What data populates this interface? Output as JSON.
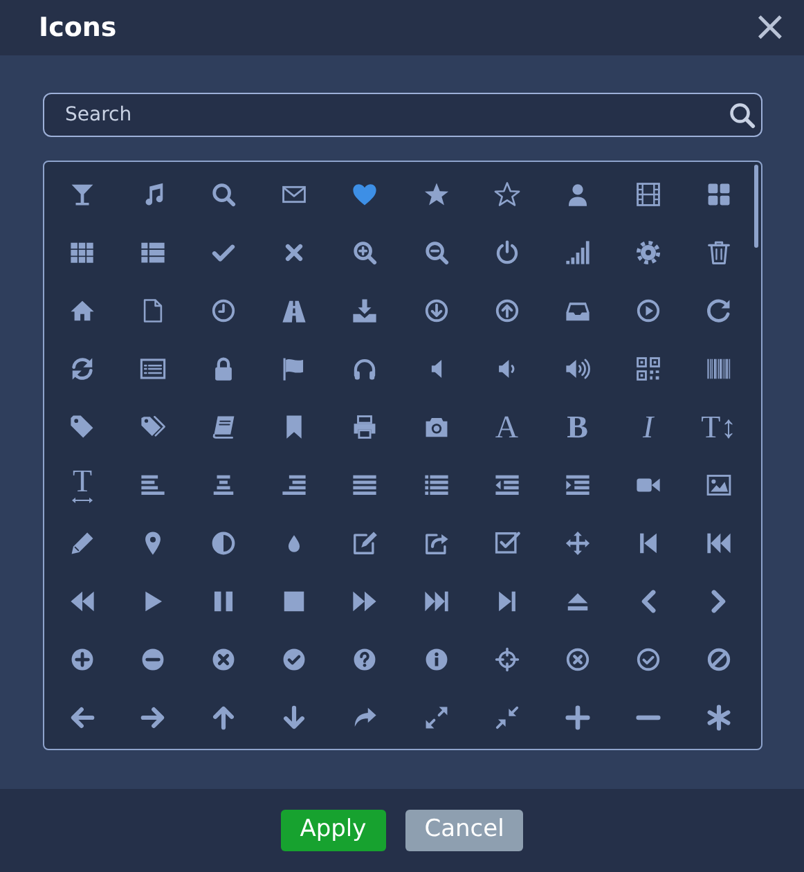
{
  "dialog": {
    "title": "Icons",
    "close": "×"
  },
  "search": {
    "placeholder": "Search"
  },
  "icons": [
    {
      "selected": false
    },
    {
      "selected": false
    },
    {
      "selected": false
    },
    {
      "selected": false
    },
    {
      "selected": true
    },
    {
      "selected": false
    },
    {
      "selected": false
    },
    {
      "selected": false
    },
    {
      "selected": false
    },
    {
      "selected": false
    },
    {
      "selected": false
    },
    {
      "selected": false
    },
    {
      "selected": false
    },
    {
      "selected": false
    },
    {
      "selected": false
    },
    {
      "selected": false
    },
    {
      "selected": false
    },
    {
      "selected": false
    },
    {
      "selected": false
    },
    {
      "selected": false
    },
    {
      "selected": false
    },
    {
      "selected": false
    },
    {
      "selected": false
    },
    {
      "selected": false
    },
    {
      "selected": false
    },
    {
      "selected": false
    },
    {
      "selected": false
    },
    {
      "selected": false
    },
    {
      "selected": false
    },
    {
      "selected": false
    },
    {
      "selected": false
    },
    {
      "selected": false
    },
    {
      "selected": false
    },
    {
      "selected": false
    },
    {
      "selected": false
    },
    {
      "selected": false
    },
    {
      "selected": false
    },
    {
      "selected": false
    },
    {
      "selected": false
    },
    {
      "selected": false
    },
    {
      "selected": false
    },
    {
      "selected": false
    },
    {
      "selected": false
    },
    {
      "selected": false
    },
    {
      "selected": false
    },
    {
      "selected": false
    },
    {
      "selected": false,
      "text": "A"
    },
    {
      "selected": false,
      "text": "B"
    },
    {
      "selected": false,
      "text": "I"
    },
    {
      "selected": false,
      "text": "T↕"
    },
    {
      "selected": false,
      "text": "T"
    },
    {
      "selected": false
    },
    {
      "selected": false
    },
    {
      "selected": false
    },
    {
      "selected": false
    },
    {
      "selected": false
    },
    {
      "selected": false
    },
    {
      "selected": false
    },
    {
      "selected": false
    },
    {
      "selected": false
    },
    {
      "selected": false
    },
    {
      "selected": false
    },
    {
      "selected": false
    },
    {
      "selected": false
    },
    {
      "selected": false
    },
    {
      "selected": false
    },
    {
      "selected": false
    },
    {
      "selected": false
    },
    {
      "selected": false
    },
    {
      "selected": false
    },
    {
      "selected": false
    },
    {
      "selected": false
    },
    {
      "selected": false
    },
    {
      "selected": false
    },
    {
      "selected": false
    },
    {
      "selected": false
    },
    {
      "selected": false
    },
    {
      "selected": false
    },
    {
      "selected": false
    },
    {
      "selected": false
    },
    {
      "selected": false
    },
    {
      "selected": false
    },
    {
      "selected": false
    },
    {
      "selected": false
    },
    {
      "selected": false
    },
    {
      "selected": false
    },
    {
      "selected": false
    },
    {
      "selected": false
    },
    {
      "selected": false
    },
    {
      "selected": false
    },
    {
      "selected": false
    },
    {
      "selected": false
    },
    {
      "selected": false
    },
    {
      "selected": false
    },
    {
      "selected": false
    },
    {
      "selected": false
    },
    {
      "selected": false
    },
    {
      "selected": false
    },
    {
      "selected": false
    },
    {
      "selected": false
    }
  ],
  "buttons": [
    {
      "label": "Apply",
      "kind": "primary"
    },
    {
      "label": "Cancel",
      "kind": "secondary"
    }
  ]
}
